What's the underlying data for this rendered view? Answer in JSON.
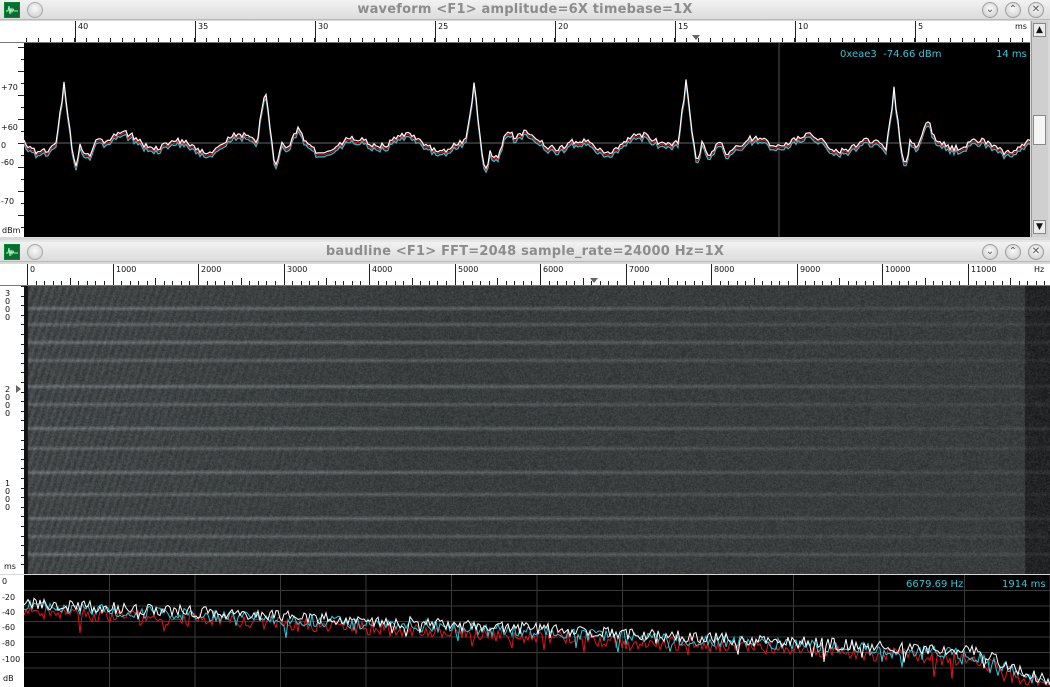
{
  "waveform": {
    "title": "waveform  <F1> amplitude=6X timebase=1X",
    "time_ticks": [
      "40",
      "35",
      "30",
      "25",
      "20",
      "15",
      "10",
      "5"
    ],
    "time_unit": "ms",
    "amp_ticks": [
      "+70",
      "+60",
      "0",
      "-60",
      "-70"
    ],
    "amp_unit": "dBm",
    "readout_value": "0xeae3  -74.66 dBm",
    "readout_time": "14 ms"
  },
  "baudline": {
    "title": "baudline  <F1> FFT=2048 sample_rate=24000 Hz=1X",
    "freq_ticks": [
      "0",
      "1000",
      "2000",
      "3000",
      "4000",
      "5000",
      "6000",
      "7000",
      "8000",
      "9000",
      "10000",
      "11000"
    ],
    "freq_unit": "Hz",
    "time_ticks": [
      "3\n0\n0\n0",
      "2\n0\n0\n0",
      "1\n0\n0\n0"
    ],
    "time_unit": "ms"
  },
  "spectrum": {
    "db_ticks": [
      "0",
      "-20",
      "-40",
      "-60",
      "-80",
      "-100"
    ],
    "db_unit": "dB",
    "readout_freq": "6679.69 Hz",
    "readout_time": "1914 ms"
  },
  "colors": {
    "trace_white": "#ffffff",
    "trace_cyan": "#2ec8d8",
    "trace_red": "#e0161c",
    "readout": "#35c6d6"
  },
  "icons": [
    "baudline-app-icon",
    "menu-icon",
    "minimize-icon",
    "maximize-icon",
    "close-icon",
    "scroll-up-icon",
    "scroll-down-icon",
    "cursor-marker-icon"
  ]
}
